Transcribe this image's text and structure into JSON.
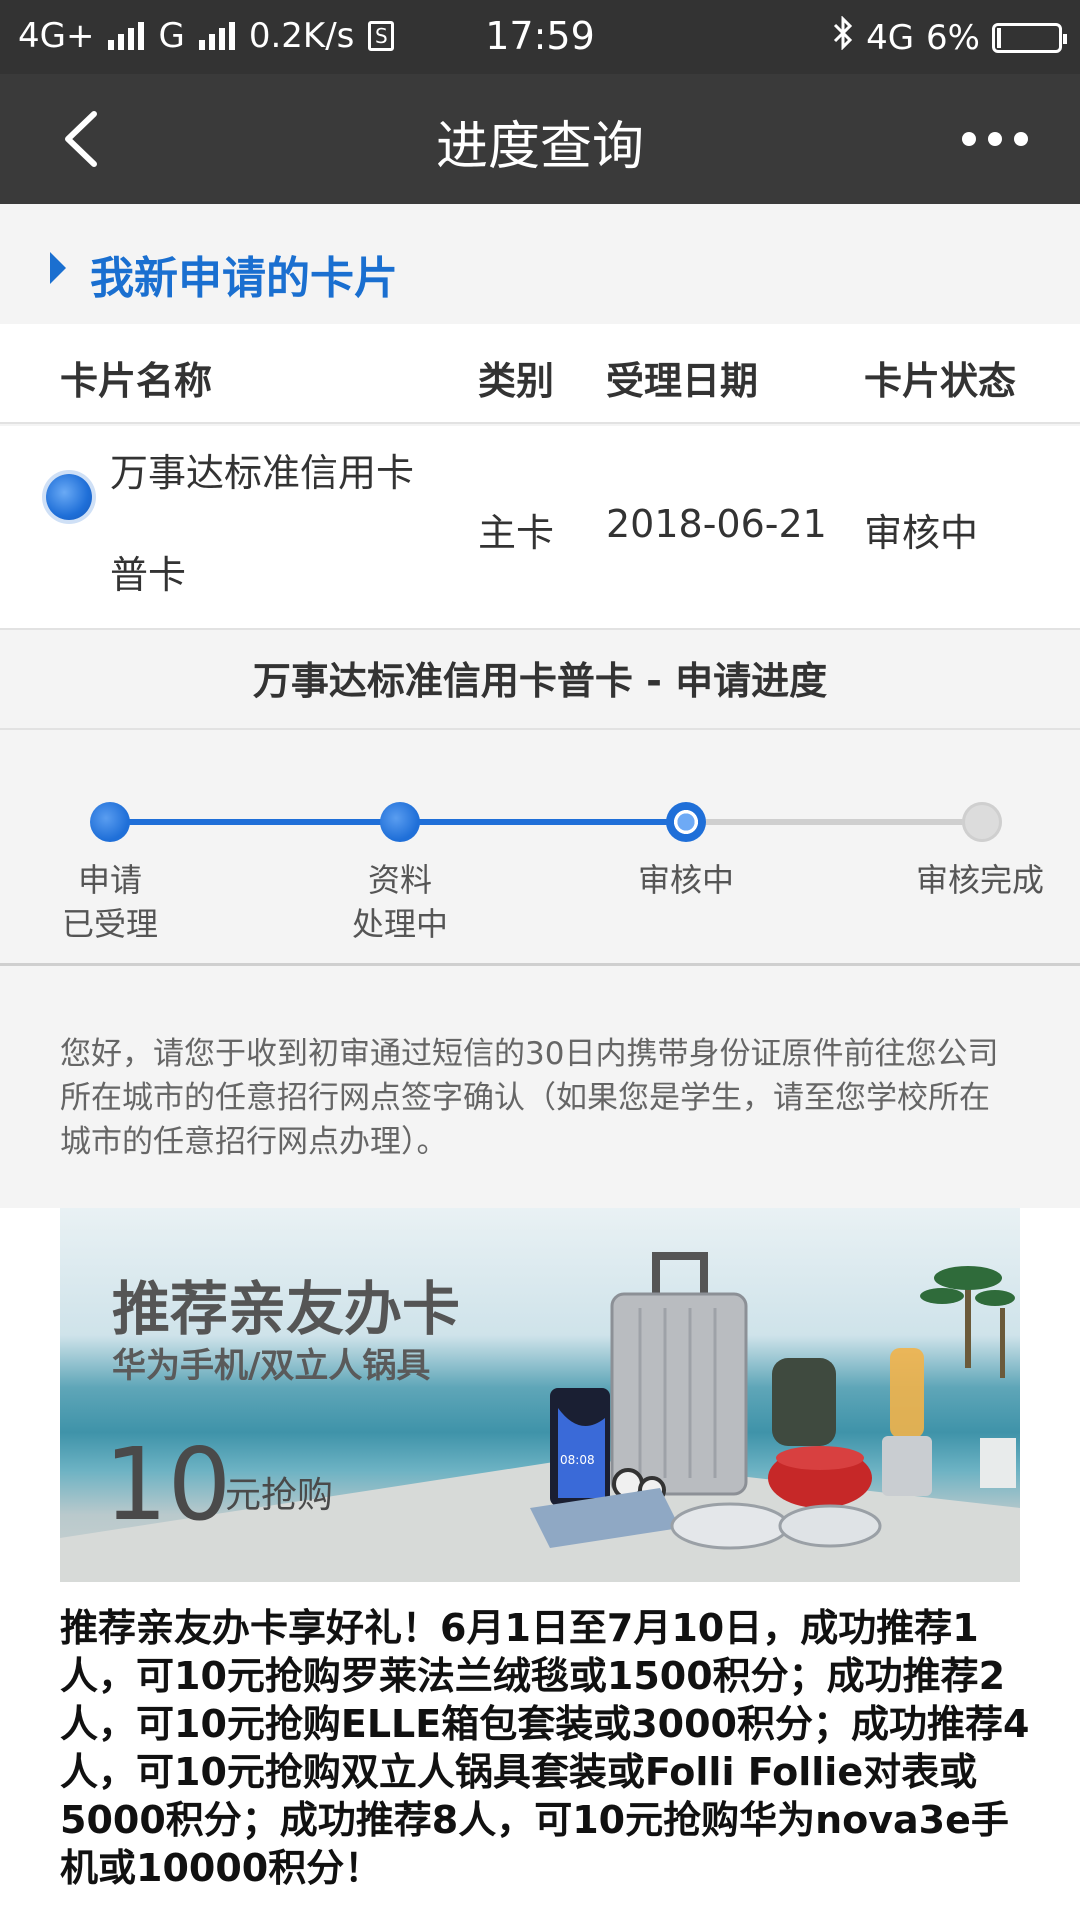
{
  "status_bar": {
    "network1": "4G+",
    "network2": "G",
    "speed": "0.2K/s",
    "sim": "S",
    "time": "17:59",
    "network3": "4G",
    "battery": "6%",
    "battery_level": 0.06
  },
  "nav": {
    "title": "进度查询"
  },
  "section": {
    "title": "我新申请的卡片"
  },
  "table": {
    "headers": [
      "卡片名称",
      "类别",
      "受理日期",
      "卡片状态"
    ],
    "row": {
      "name_line1": "万事达标准信用卡",
      "name_line2": "普卡",
      "category": "主卡",
      "date": "2018-06-21",
      "status": "审核中"
    }
  },
  "progress": {
    "title": "万事达标准信用卡普卡 - 申请进度",
    "steps": [
      {
        "line1": "申请",
        "line2": "已受理",
        "state": "done"
      },
      {
        "line1": "资料",
        "line2": "处理中",
        "state": "done"
      },
      {
        "line1": "审核中",
        "line2": "",
        "state": "current"
      },
      {
        "line1": "审核完成",
        "line2": "",
        "state": "todo"
      }
    ]
  },
  "notice": {
    "text": "您好，请您于收到初审通过短信的30日内携带身份证原件前往您公司所在城市的任意招行网点签字确认（如果您是学生，请至您学校所在城市的任意招行网点办理）。"
  },
  "banner": {
    "title": "推荐亲友办卡",
    "subtitle": "华为手机/双立人锅具",
    "price_number": "10",
    "price_unit": "元抢购",
    "phone_time": "08:08"
  },
  "promo": {
    "text": "推荐亲友办卡享好礼！6月1日至7月10日，成功推荐1人，可10元抢购罗莱法兰绒毯或1500积分；成功推荐2人，可10元抢购ELLE箱包套装或3000积分；成功推荐4人，可10元抢购双立人锅具套装或Folli Follie对表或5000积分；成功推荐8人，可10元抢购华为nova3e手机或10000积分！"
  },
  "colors": {
    "accent": "#1a6fd0",
    "nav_bg": "#3a3a3a",
    "status_bg": "#333333"
  }
}
